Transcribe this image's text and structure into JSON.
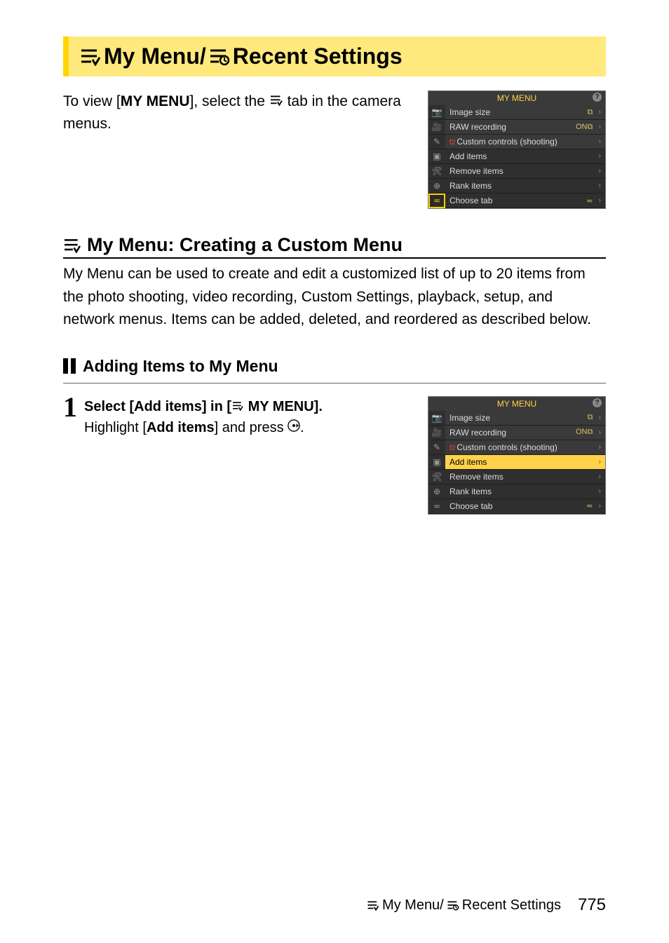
{
  "pageTitle": {
    "part1": "My Menu/",
    "part2": "Recent Settings"
  },
  "intro": {
    "pre": "To view [",
    "bold": "MY MENU",
    "post": "], select the ",
    "post2": " tab in the camera menus."
  },
  "lcd1": {
    "title": "MY MENU",
    "tabs": [
      "📷",
      "🎥",
      "✎",
      "▣",
      "🛠",
      "⊕",
      "≂"
    ],
    "selectedTab": 6,
    "items": [
      {
        "label": "Image size",
        "value": "⧉",
        "dark": false
      },
      {
        "label": "RAW recording",
        "value": "ON⧉",
        "dark": false
      },
      {
        "label": "Custom controls (shooting)",
        "value": "",
        "prefix": "f2",
        "dark": false
      },
      {
        "label": "Add items",
        "value": "",
        "dark": true
      },
      {
        "label": "Remove items",
        "value": "",
        "dark": true
      },
      {
        "label": "Rank items",
        "value": "",
        "dark": true
      },
      {
        "label": "Choose tab",
        "value": "≂",
        "dark": true
      }
    ]
  },
  "section": {
    "heading": "My Menu: Creating a Custom Menu",
    "body": "My Menu can be used to create and edit a customized list of up to 20 items from the photo shooting, video recording, Custom Settings, playback, setup, and network menus. Items can be added, deleted, and reordered as described below."
  },
  "subhead": "Adding Items to My Menu",
  "step1": {
    "num": "1",
    "title_pre": "Select [Add items] in [",
    "title_post": " MY MENU].",
    "body_pre": "Highlight [",
    "body_bold": "Add items",
    "body_post": "] and press "
  },
  "lcd2": {
    "title": "MY MENU",
    "tabs": [
      "📷",
      "🎥",
      "✎",
      "▣",
      "🛠",
      "⊕",
      "≂"
    ],
    "selectedTab": -1,
    "items": [
      {
        "label": "Image size",
        "value": "⧉",
        "dark": false
      },
      {
        "label": "RAW recording",
        "value": "ON⧉",
        "dark": false
      },
      {
        "label": "Custom controls (shooting)",
        "value": "",
        "prefix": "f2",
        "dark": false
      },
      {
        "label": "Add items",
        "value": "",
        "hl": true
      },
      {
        "label": "Remove items",
        "value": "",
        "dark": true
      },
      {
        "label": "Rank items",
        "value": "",
        "dark": true
      },
      {
        "label": "Choose tab",
        "value": "≂",
        "dark": true
      }
    ]
  },
  "footer": {
    "title1": "My Menu/",
    "title2": "Recent Settings",
    "page": "775"
  }
}
